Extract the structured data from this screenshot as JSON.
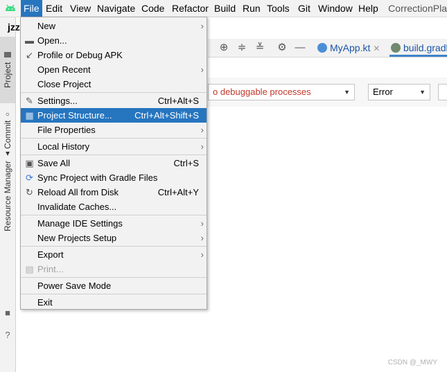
{
  "menubar": {
    "items": [
      "File",
      "Edit",
      "View",
      "Navigate",
      "Code",
      "Refactor",
      "Build",
      "Run",
      "Tools",
      "Git",
      "Window",
      "Help"
    ],
    "app_title": "CorrectionPla"
  },
  "project": {
    "crumb": "jzz"
  },
  "left_tabs": {
    "project": "Project",
    "commit": "Commit",
    "resource_manager": "Resource Manager"
  },
  "editor_tabs": [
    {
      "label": "MyApp.kt",
      "color": "#4a8fd6"
    },
    {
      "label": "build.gradl",
      "color": "#6f8a6f"
    }
  ],
  "logcat": {
    "process": "No debuggable processes",
    "process_visible": "o debuggable processes",
    "level": "Error"
  },
  "file_menu": [
    {
      "label": "New",
      "shortcut": "",
      "submenu": true,
      "icon": ""
    },
    {
      "label": "Open...",
      "shortcut": "",
      "submenu": false,
      "icon": "folder-icon"
    },
    {
      "label": "Profile or Debug APK",
      "shortcut": "",
      "submenu": false,
      "icon": "profile-icon"
    },
    {
      "label": "Open Recent",
      "shortcut": "",
      "submenu": true,
      "icon": ""
    },
    {
      "label": "Close Project",
      "shortcut": "",
      "submenu": false,
      "icon": ""
    },
    {
      "label": "Settings...",
      "shortcut": "Ctrl+Alt+S",
      "submenu": false,
      "icon": "wrench-icon"
    },
    {
      "label": "Project Structure...",
      "shortcut": "Ctrl+Alt+Shift+S",
      "submenu": false,
      "icon": "project-structure-icon"
    },
    {
      "label": "File Properties",
      "shortcut": "",
      "submenu": true,
      "icon": ""
    },
    {
      "label": "Local History",
      "shortcut": "",
      "submenu": true,
      "icon": ""
    },
    {
      "label": "Save All",
      "shortcut": "Ctrl+S",
      "submenu": false,
      "icon": "save-icon"
    },
    {
      "label": "Sync Project with Gradle Files",
      "shortcut": "",
      "submenu": false,
      "icon": "sync-icon"
    },
    {
      "label": "Reload All from Disk",
      "shortcut": "Ctrl+Alt+Y",
      "submenu": false,
      "icon": "reload-icon"
    },
    {
      "label": "Invalidate Caches...",
      "shortcut": "",
      "submenu": false,
      "icon": ""
    },
    {
      "label": "Manage IDE Settings",
      "shortcut": "",
      "submenu": true,
      "icon": ""
    },
    {
      "label": "New Projects Setup",
      "shortcut": "",
      "submenu": true,
      "icon": ""
    },
    {
      "label": "Export",
      "shortcut": "",
      "submenu": true,
      "icon": ""
    },
    {
      "label": "Print...",
      "shortcut": "",
      "submenu": false,
      "icon": "print-icon",
      "disabled": true
    },
    {
      "label": "Power Save Mode",
      "shortcut": "",
      "submenu": false,
      "icon": ""
    },
    {
      "label": "Exit",
      "shortcut": "",
      "submenu": false,
      "icon": ""
    }
  ],
  "watermark": "CSDN @_MWY",
  "colors": {
    "menu_highlight": "#2675bf",
    "menu_bg": "#f2f2f2",
    "error_text": "#c0392b"
  }
}
